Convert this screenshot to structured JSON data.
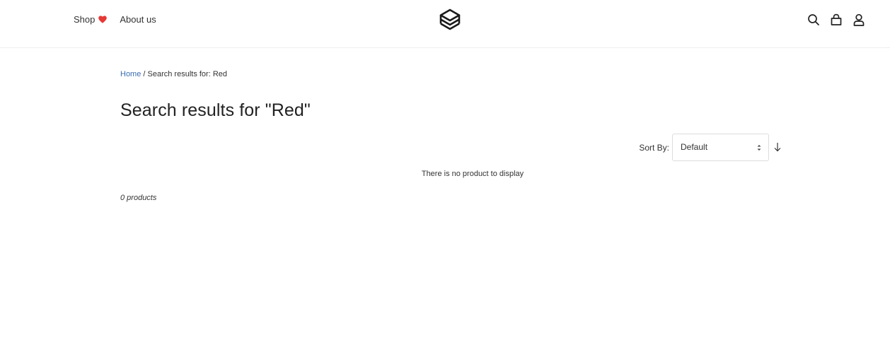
{
  "header": {
    "nav": [
      {
        "label": "Shop"
      },
      {
        "label": "About us"
      }
    ],
    "icons": [
      "search-icon",
      "shopping-bag-icon",
      "user-icon"
    ],
    "heart_color": "#e53935"
  },
  "breadcrumb": {
    "home": "Home",
    "separator": " / ",
    "current": "Search results for: Red"
  },
  "page": {
    "title": "Search results for \"Red\"",
    "sort_label": "Sort By:",
    "sort_selected": "Default",
    "empty_message": "There is no product to display",
    "product_count": "0 products"
  },
  "colors": {
    "link": "#3b6db3",
    "text": "#222222"
  }
}
